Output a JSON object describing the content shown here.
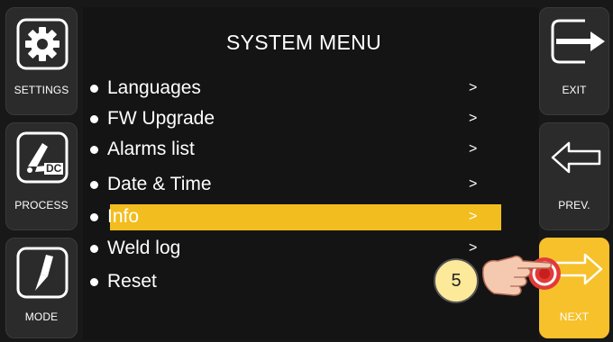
{
  "title": "SYSTEM MENU",
  "left_buttons": [
    {
      "label": "SETTINGS",
      "icon": "gear-icon"
    },
    {
      "label": "PROCESS",
      "icon": "torch-dc-icon",
      "badge": "DC"
    },
    {
      "label": "MODE",
      "icon": "trigger-mode-icon"
    }
  ],
  "right_buttons": [
    {
      "label": "EXIT",
      "icon": "exit-arrow-icon"
    },
    {
      "label": "PREV.",
      "icon": "left-arrow-icon"
    },
    {
      "label": "NEXT",
      "icon": "right-arrow-icon"
    }
  ],
  "menu": {
    "items": [
      {
        "label": "Languages",
        "arrow": ">"
      },
      {
        "label": "FW Upgrade",
        "arrow": ">"
      },
      {
        "label": "Alarms list",
        "arrow": ">"
      },
      {
        "label": "Date & Time",
        "arrow": ">"
      },
      {
        "label": "Info",
        "arrow": ">",
        "selected": true
      },
      {
        "label": "Weld log",
        "arrow": ">"
      },
      {
        "label": "Reset",
        "arrow": ""
      }
    ]
  },
  "step_badge": "5",
  "colors": {
    "highlight": "#f2bd1f",
    "next_button": "#f6c12a",
    "panel": "#141414"
  }
}
